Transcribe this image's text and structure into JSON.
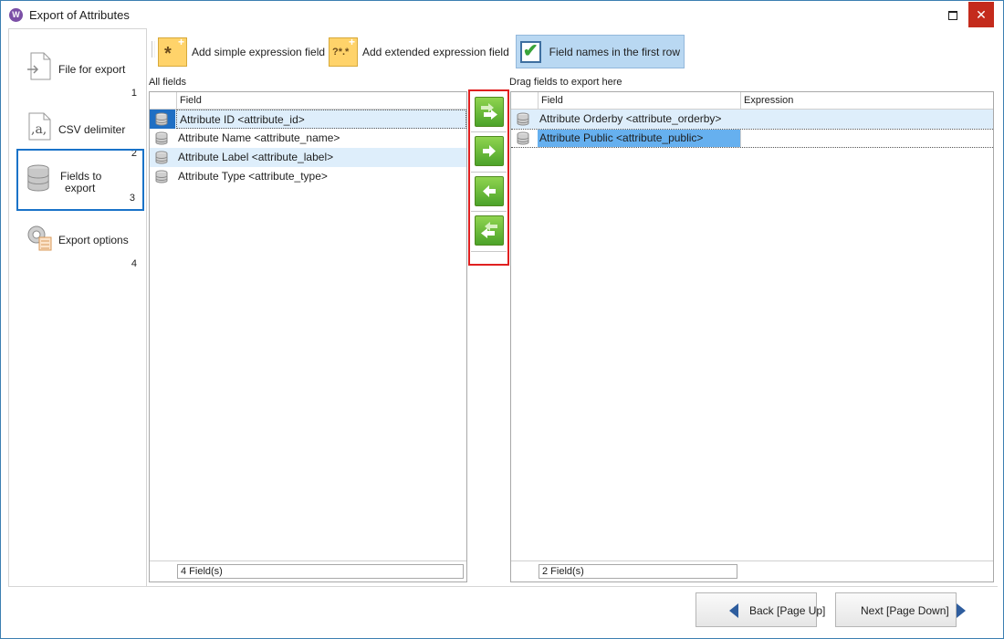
{
  "window": {
    "title": "Export of Attributes",
    "app_icon_letter": "W"
  },
  "steps": [
    {
      "label": "File for export",
      "number": "1",
      "icon": "document-icon"
    },
    {
      "label": "CSV delimiter",
      "number": "2",
      "icon": "delimiter-icon"
    },
    {
      "label_line1": "Fields to",
      "label_line2": "export",
      "number": "3",
      "icon": "database-icon",
      "active": true
    },
    {
      "label": "Export options",
      "number": "4",
      "icon": "settings-icon"
    }
  ],
  "toolbar": {
    "add_simple": "Add simple expression field",
    "add_extended": "Add extended expression field",
    "field_names_first_row": "Field names in the first row",
    "field_names_checked": true
  },
  "left_grid": {
    "caption": "All fields",
    "column_field": "Field",
    "rows": [
      "Attribute ID <attribute_id>",
      "Attribute Name <attribute_name>",
      "Attribute Label <attribute_label>",
      "Attribute Type <attribute_type>"
    ],
    "footer": "4 Field(s)"
  },
  "right_grid": {
    "caption": "Drag fields to export here",
    "column_field": "Field",
    "column_expression": "Expression",
    "rows": [
      "Attribute Orderby <attribute_orderby>",
      "Attribute Public <attribute_public>"
    ],
    "footer": "2 Field(s)"
  },
  "navigation": {
    "back": "Back [Page Up]",
    "next": "Next [Page Down]"
  },
  "colors": {
    "accent": "#1a73c8",
    "highlight_red": "#e02020",
    "selection": "#66b0ef",
    "row_highlight": "#deeefb"
  }
}
